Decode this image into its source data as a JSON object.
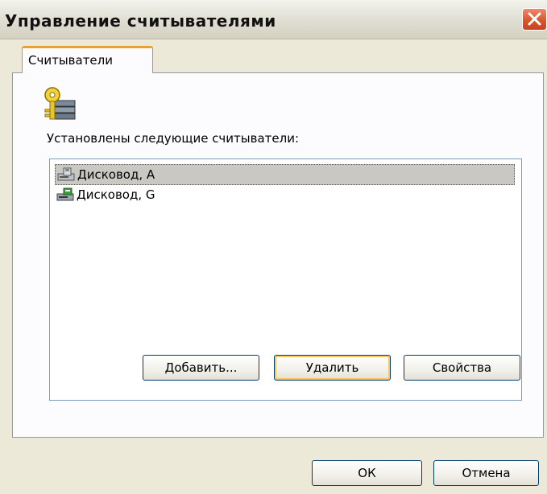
{
  "window": {
    "title": "Управление считывателями"
  },
  "tabs": [
    {
      "label": "Считыватели"
    }
  ],
  "panel": {
    "label": "Установлены следующие считыватели:",
    "readers": [
      {
        "label": "Дисковод, A",
        "selected": true,
        "icon": "floppy-drive-icon"
      },
      {
        "label": "Дисковод, G",
        "selected": false,
        "icon": "removable-drive-icon"
      }
    ],
    "buttons": {
      "add": "Добавить...",
      "delete": "Удалить",
      "properties": "Свойства"
    }
  },
  "footer": {
    "ok": "ОК",
    "cancel": "Отмена"
  },
  "colors": {
    "accent": "#e9a230",
    "window_bg": "#ece9d8",
    "close_button": "#d8562e"
  }
}
